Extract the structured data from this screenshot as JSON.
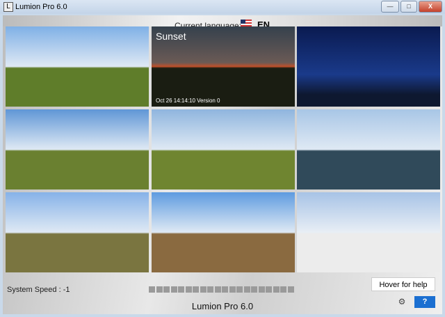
{
  "window": {
    "title": "Lumion Pro 6.0",
    "minimize": "—",
    "maximize": "□",
    "close": "X"
  },
  "header": {
    "language_label": "Current language:",
    "language_code": "EN"
  },
  "scenes": [
    {
      "name": "",
      "date": "",
      "sky": "#7fb0e6",
      "ground": "#5f7d2a"
    },
    {
      "name": "Sunset",
      "date": "Oct 26 14:14:10 Version 0",
      "sky": "#3f4a55",
      "ground": "#1a1d12"
    },
    {
      "name": "",
      "date": "",
      "sky": "#0c1f5a",
      "ground": "#101a2a"
    },
    {
      "name": "",
      "date": "",
      "sky": "#5f96d6",
      "ground": "#6a8030"
    },
    {
      "name": "",
      "date": "",
      "sky": "#8fb5de",
      "ground": "#6f8530"
    },
    {
      "name": "",
      "date": "",
      "sky": "#a8c6e6",
      "ground": "#304a5a"
    },
    {
      "name": "",
      "date": "",
      "sky": "#86b2e8",
      "ground": "#7a7540"
    },
    {
      "name": "",
      "date": "",
      "sky": "#5e9be0",
      "ground": "#8a6a40"
    },
    {
      "name": "",
      "date": "",
      "sky": "#a7c3e6",
      "ground": "#e6e6e6"
    }
  ],
  "status": {
    "system_speed": "System Speed : -1",
    "speed_blocks": 20
  },
  "help": {
    "hover_label": "Hover for help",
    "help_button": "?",
    "settings_icon": "gear-icon"
  },
  "footer": {
    "title": "Lumion Pro 6.0"
  }
}
